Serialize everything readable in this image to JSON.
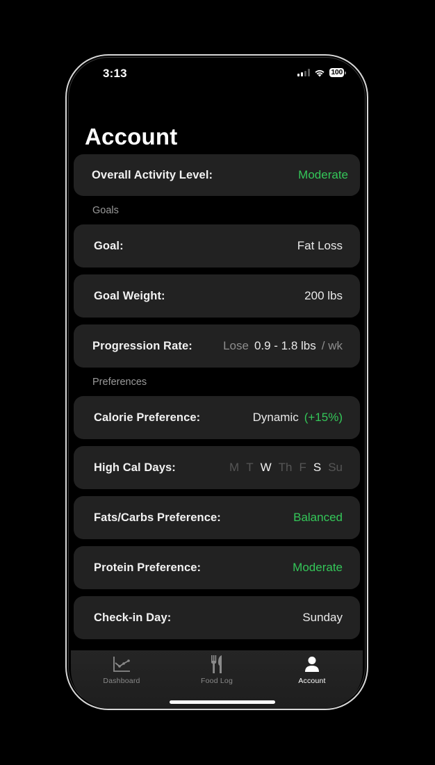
{
  "status_bar": {
    "time": "3:13",
    "battery": "100",
    "icons": [
      "cellular-signal-icon",
      "wifi-icon",
      "battery-icon"
    ]
  },
  "header": {
    "title": "Account"
  },
  "activity": {
    "label": "Overall Activity Level:",
    "value": "Moderate"
  },
  "sections": {
    "goals_label": "Goals",
    "preferences_label": "Preferences"
  },
  "goals": {
    "goal": {
      "label": "Goal:",
      "value": "Fat Loss"
    },
    "goal_weight": {
      "label": "Goal Weight:",
      "value": "200 lbs"
    },
    "progression_rate": {
      "label": "Progression Rate:",
      "prefix": "Lose",
      "value": "0.9 - 1.8 lbs",
      "suffix": "/ wk"
    }
  },
  "preferences": {
    "calorie": {
      "label": "Calorie Preference:",
      "value": "Dynamic",
      "modifier": "(+15%)"
    },
    "high_cal_days": {
      "label": "High Cal Days:",
      "days": [
        {
          "label": "M",
          "selected": false
        },
        {
          "label": "T",
          "selected": false
        },
        {
          "label": "W",
          "selected": true
        },
        {
          "label": "Th",
          "selected": false
        },
        {
          "label": "F",
          "selected": false
        },
        {
          "label": "S",
          "selected": true
        },
        {
          "label": "Su",
          "selected": false
        }
      ]
    },
    "fats_carbs": {
      "label": "Fats/Carbs Preference:",
      "value": "Balanced"
    },
    "protein": {
      "label": "Protein Preference:",
      "value": "Moderate"
    },
    "check_in": {
      "label": "Check-in Day:",
      "value": "Sunday"
    }
  },
  "tab_bar": {
    "tabs": [
      {
        "label": "Dashboard",
        "icon": "chart-line-icon",
        "active": false
      },
      {
        "label": "Food Log",
        "icon": "fork-knife-icon",
        "active": false
      },
      {
        "label": "Account",
        "icon": "person-icon",
        "active": true
      }
    ]
  },
  "colors": {
    "accent_green": "#34c759",
    "card_bg": "#222222",
    "background": "#000000"
  }
}
